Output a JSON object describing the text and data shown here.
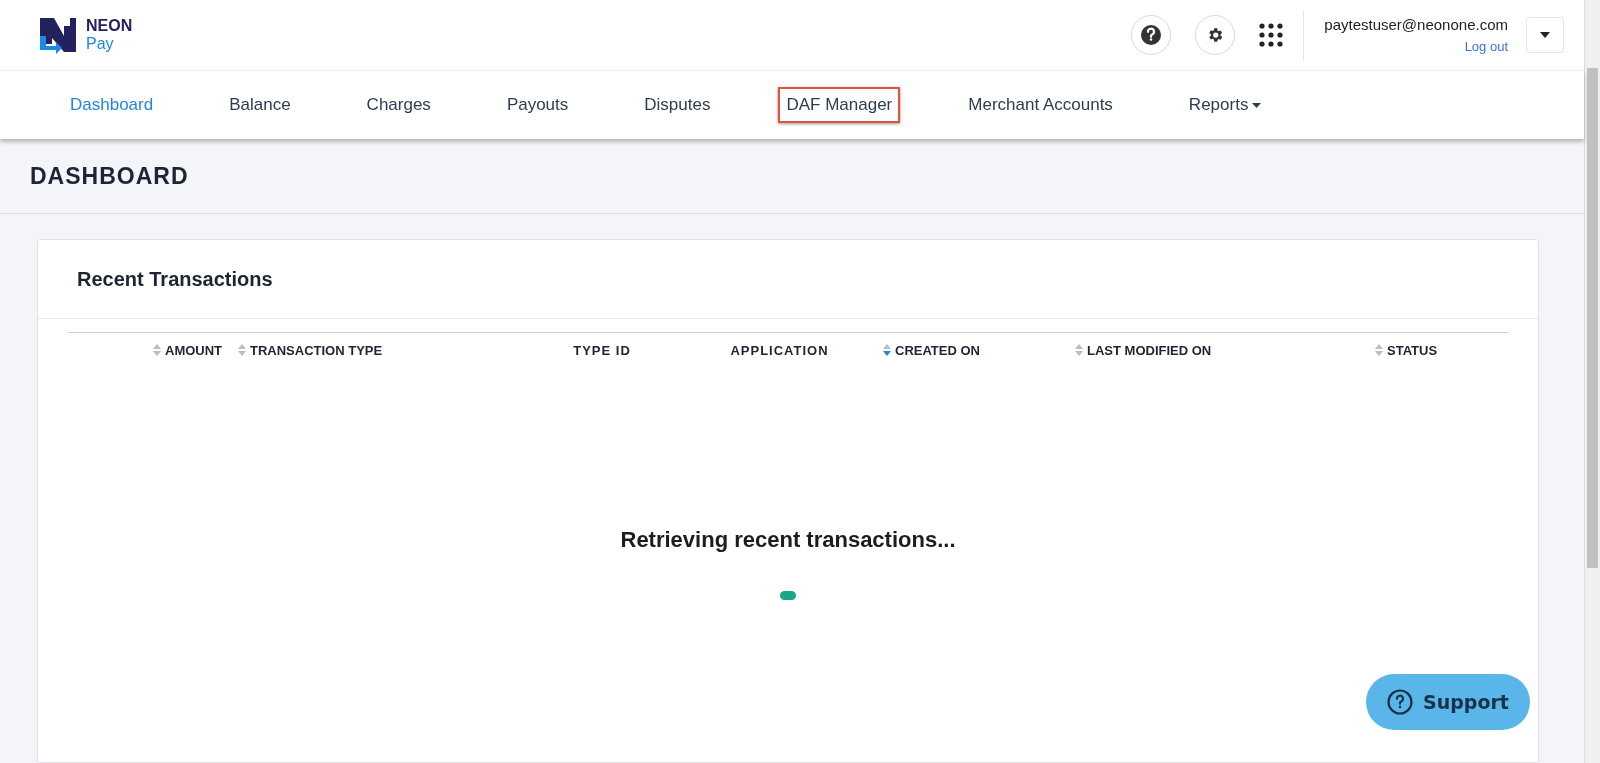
{
  "brand": {
    "name": "NEON",
    "sub": "Pay"
  },
  "user": {
    "email": "paytestuser@neonone.com",
    "logout": "Log out"
  },
  "nav": [
    {
      "label": "Dashboard",
      "selected": true,
      "highlighted": false,
      "dropdown": false
    },
    {
      "label": "Balance",
      "selected": false,
      "highlighted": false,
      "dropdown": false
    },
    {
      "label": "Charges",
      "selected": false,
      "highlighted": false,
      "dropdown": false
    },
    {
      "label": "Payouts",
      "selected": false,
      "highlighted": false,
      "dropdown": false
    },
    {
      "label": "Disputes",
      "selected": false,
      "highlighted": false,
      "dropdown": false
    },
    {
      "label": "DAF Manager",
      "selected": false,
      "highlighted": true,
      "dropdown": false
    },
    {
      "label": "Merchant Accounts",
      "selected": false,
      "highlighted": false,
      "dropdown": false
    },
    {
      "label": "Reports",
      "selected": false,
      "highlighted": false,
      "dropdown": true
    }
  ],
  "page_title": "DASHBOARD",
  "card": {
    "title": "Recent Transactions",
    "columns": [
      {
        "label": "AMOUNT",
        "sortable": true,
        "sorted": false
      },
      {
        "label": "TRANSACTION TYPE",
        "sortable": true,
        "sorted": false
      },
      {
        "label": "TYPE ID",
        "sortable": false
      },
      {
        "label": "APPLICATION",
        "sortable": false
      },
      {
        "label": "CREATED ON",
        "sortable": true,
        "sorted": true
      },
      {
        "label": "LAST MODIFIED ON",
        "sortable": true,
        "sorted": false
      },
      {
        "label": "STATUS",
        "sortable": true,
        "sorted": false
      }
    ],
    "loading_text": "Retrieving recent transactions..."
  },
  "support": {
    "label": "Support"
  }
}
